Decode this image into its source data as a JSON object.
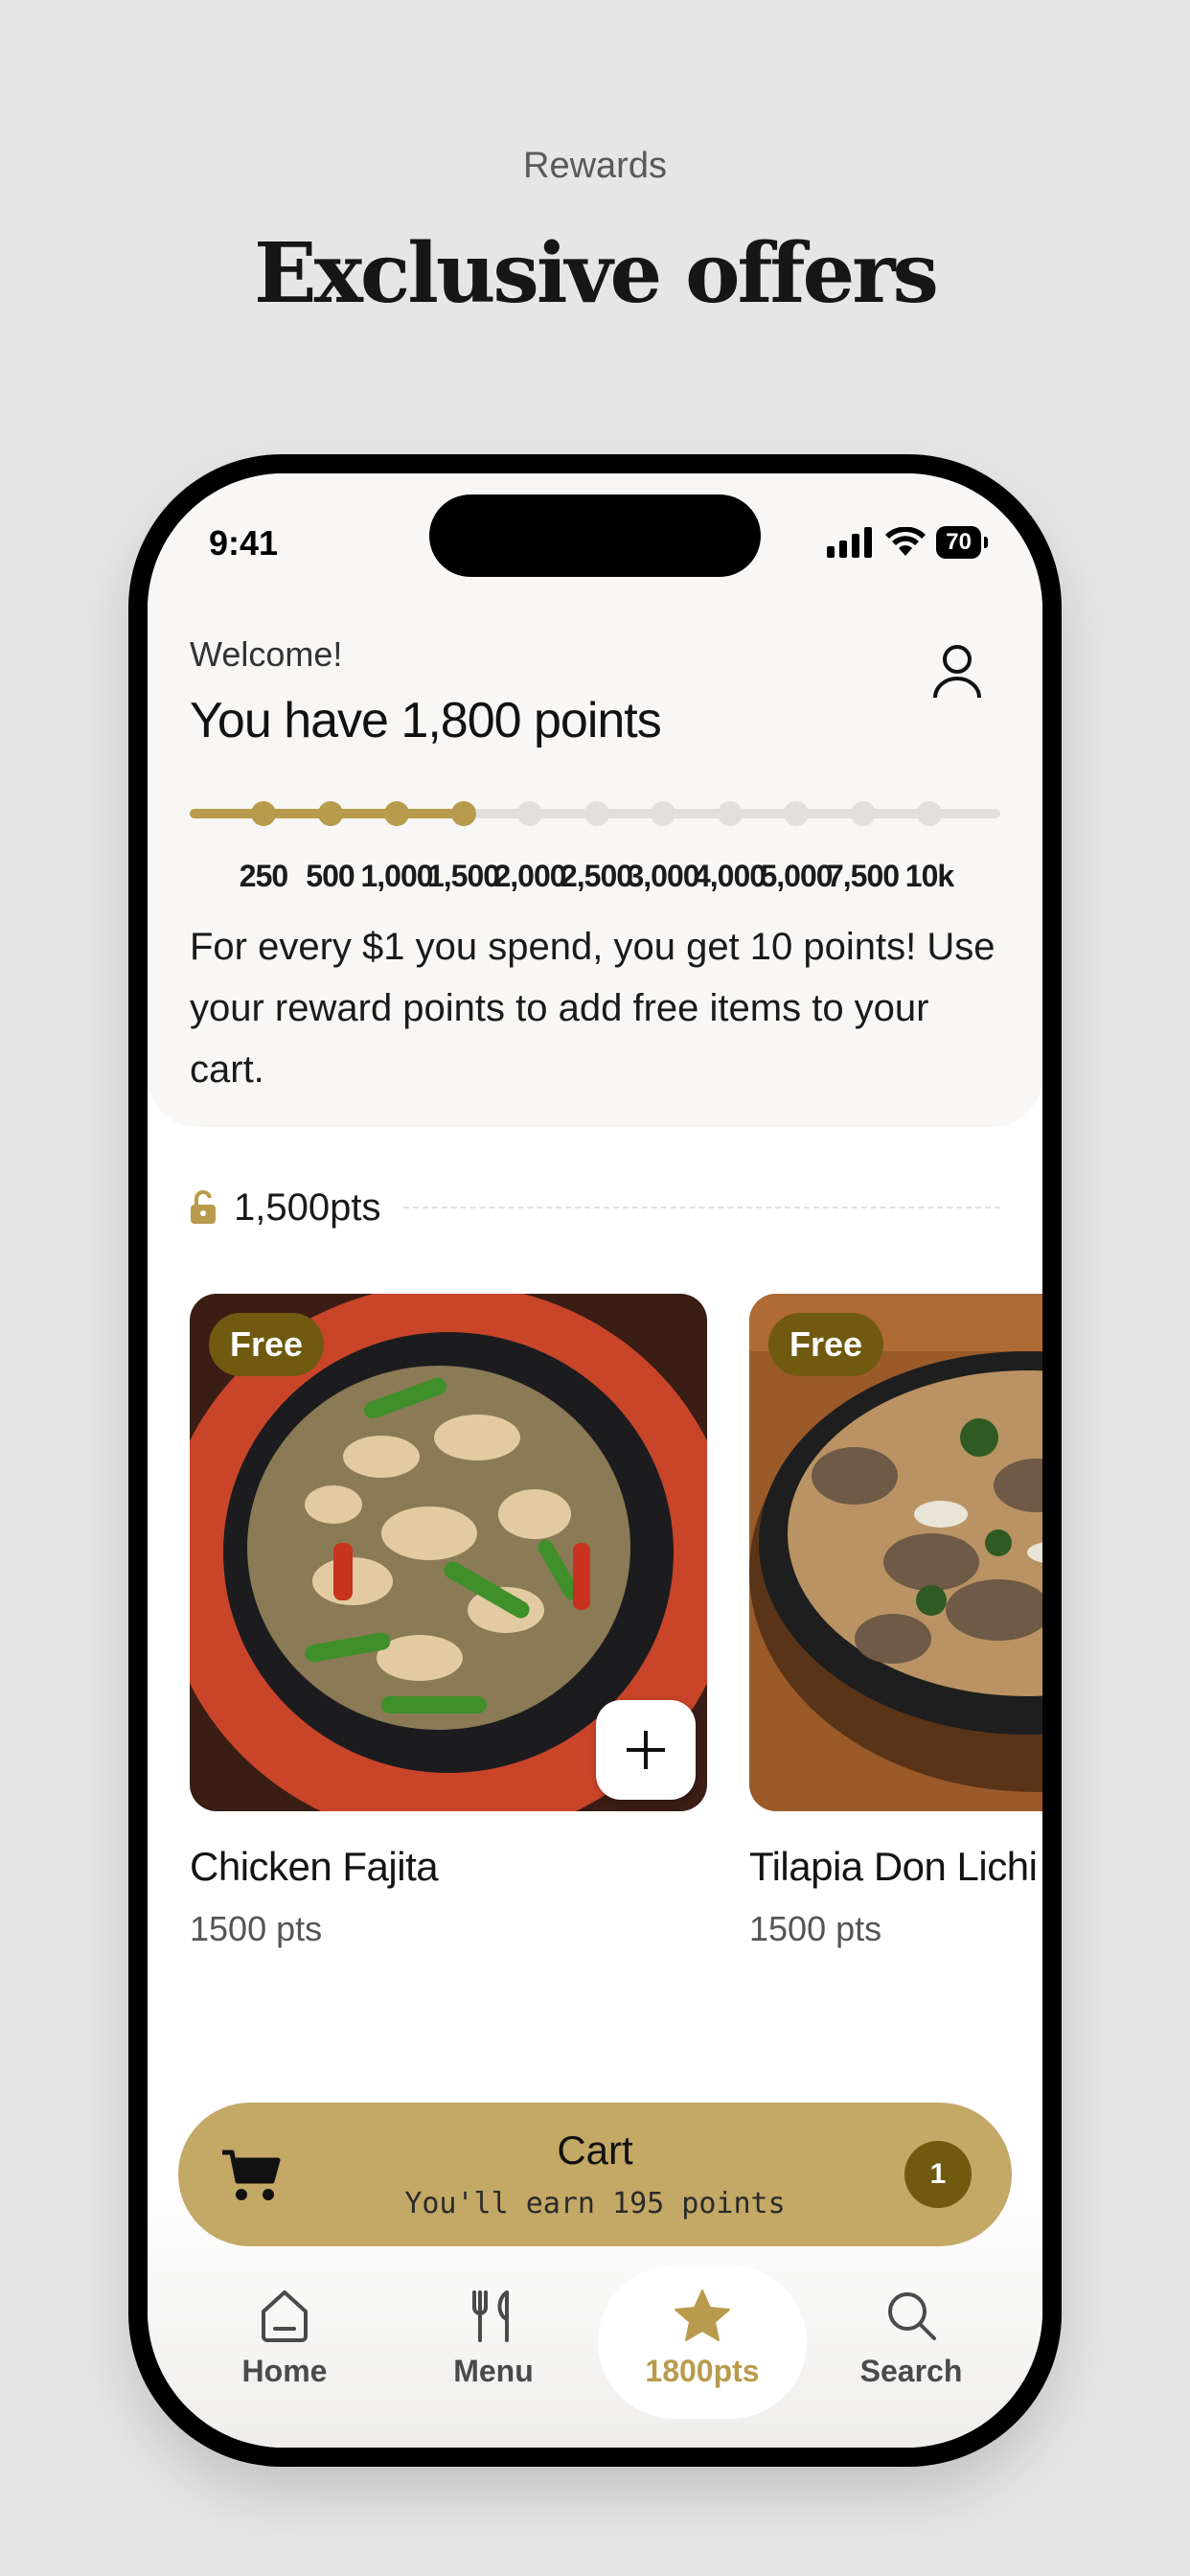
{
  "promo": {
    "subtitle": "Rewards",
    "title": "Exclusive offers"
  },
  "status_bar": {
    "time": "9:41",
    "battery": "70"
  },
  "header": {
    "welcome": "Welcome!",
    "points_title": "You have 1,800 points"
  },
  "progress": {
    "current_points": 1800,
    "milestones": [
      "250",
      "500",
      "1,000",
      "1,500",
      "2,000",
      "2,500",
      "3,000",
      "4,000",
      "5,000",
      "7,500",
      "10k"
    ],
    "reached_count": 4,
    "accent_color": "#b89b4c",
    "inactive_color": "#e1e0dc"
  },
  "description": "For every $1 you spend, you get 10 points! Use your reward points to add free items to your cart.",
  "tier": {
    "label": "1,500pts",
    "icon": "unlocked-lock-icon"
  },
  "rewards": [
    {
      "badge": "Free",
      "name": "Chicken Fajita",
      "points": "1500 pts"
    },
    {
      "badge": "Free",
      "name": "Tilapia Don Lichi",
      "points": "1500 pts"
    }
  ],
  "cart": {
    "title": "Cart",
    "subtitle": "You'll earn 195 points",
    "count": "1"
  },
  "tabs": {
    "home": "Home",
    "menu": "Menu",
    "rewards": "1800pts",
    "search": "Search"
  }
}
